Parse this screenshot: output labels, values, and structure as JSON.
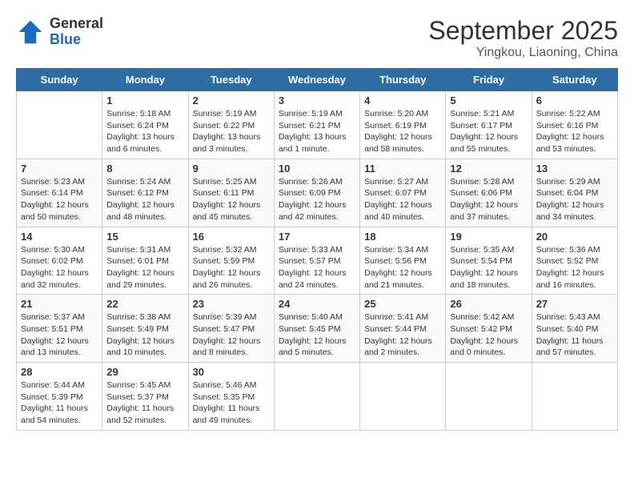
{
  "logo": {
    "line1": "General",
    "line2": "Blue"
  },
  "title": "September 2025",
  "subtitle": "Yingkou, Liaoning, China",
  "columns": [
    "Sunday",
    "Monday",
    "Tuesday",
    "Wednesday",
    "Thursday",
    "Friday",
    "Saturday"
  ],
  "weeks": [
    [
      {
        "day": "",
        "text": ""
      },
      {
        "day": "1",
        "text": "Sunrise: 5:18 AM\nSunset: 6:24 PM\nDaylight: 13 hours\nand 6 minutes."
      },
      {
        "day": "2",
        "text": "Sunrise: 5:19 AM\nSunset: 6:22 PM\nDaylight: 13 hours\nand 3 minutes."
      },
      {
        "day": "3",
        "text": "Sunrise: 5:19 AM\nSunset: 6:21 PM\nDaylight: 13 hours\nand 1 minute."
      },
      {
        "day": "4",
        "text": "Sunrise: 5:20 AM\nSunset: 6:19 PM\nDaylight: 12 hours\nand 58 minutes."
      },
      {
        "day": "5",
        "text": "Sunrise: 5:21 AM\nSunset: 6:17 PM\nDaylight: 12 hours\nand 55 minutes."
      },
      {
        "day": "6",
        "text": "Sunrise: 5:22 AM\nSunset: 6:16 PM\nDaylight: 12 hours\nand 53 minutes."
      }
    ],
    [
      {
        "day": "7",
        "text": "Sunrise: 5:23 AM\nSunset: 6:14 PM\nDaylight: 12 hours\nand 50 minutes."
      },
      {
        "day": "8",
        "text": "Sunrise: 5:24 AM\nSunset: 6:12 PM\nDaylight: 12 hours\nand 48 minutes."
      },
      {
        "day": "9",
        "text": "Sunrise: 5:25 AM\nSunset: 6:11 PM\nDaylight: 12 hours\nand 45 minutes."
      },
      {
        "day": "10",
        "text": "Sunrise: 5:26 AM\nSunset: 6:09 PM\nDaylight: 12 hours\nand 42 minutes."
      },
      {
        "day": "11",
        "text": "Sunrise: 5:27 AM\nSunset: 6:07 PM\nDaylight: 12 hours\nand 40 minutes."
      },
      {
        "day": "12",
        "text": "Sunrise: 5:28 AM\nSunset: 6:06 PM\nDaylight: 12 hours\nand 37 minutes."
      },
      {
        "day": "13",
        "text": "Sunrise: 5:29 AM\nSunset: 6:04 PM\nDaylight: 12 hours\nand 34 minutes."
      }
    ],
    [
      {
        "day": "14",
        "text": "Sunrise: 5:30 AM\nSunset: 6:02 PM\nDaylight: 12 hours\nand 32 minutes."
      },
      {
        "day": "15",
        "text": "Sunrise: 5:31 AM\nSunset: 6:01 PM\nDaylight: 12 hours\nand 29 minutes."
      },
      {
        "day": "16",
        "text": "Sunrise: 5:32 AM\nSunset: 5:59 PM\nDaylight: 12 hours\nand 26 minutes."
      },
      {
        "day": "17",
        "text": "Sunrise: 5:33 AM\nSunset: 5:57 PM\nDaylight: 12 hours\nand 24 minutes."
      },
      {
        "day": "18",
        "text": "Sunrise: 5:34 AM\nSunset: 5:56 PM\nDaylight: 12 hours\nand 21 minutes."
      },
      {
        "day": "19",
        "text": "Sunrise: 5:35 AM\nSunset: 5:54 PM\nDaylight: 12 hours\nand 18 minutes."
      },
      {
        "day": "20",
        "text": "Sunrise: 5:36 AM\nSunset: 5:52 PM\nDaylight: 12 hours\nand 16 minutes."
      }
    ],
    [
      {
        "day": "21",
        "text": "Sunrise: 5:37 AM\nSunset: 5:51 PM\nDaylight: 12 hours\nand 13 minutes."
      },
      {
        "day": "22",
        "text": "Sunrise: 5:38 AM\nSunset: 5:49 PM\nDaylight: 12 hours\nand 10 minutes."
      },
      {
        "day": "23",
        "text": "Sunrise: 5:39 AM\nSunset: 5:47 PM\nDaylight: 12 hours\nand 8 minutes."
      },
      {
        "day": "24",
        "text": "Sunrise: 5:40 AM\nSunset: 5:45 PM\nDaylight: 12 hours\nand 5 minutes."
      },
      {
        "day": "25",
        "text": "Sunrise: 5:41 AM\nSunset: 5:44 PM\nDaylight: 12 hours\nand 2 minutes."
      },
      {
        "day": "26",
        "text": "Sunrise: 5:42 AM\nSunset: 5:42 PM\nDaylight: 12 hours\nand 0 minutes."
      },
      {
        "day": "27",
        "text": "Sunrise: 5:43 AM\nSunset: 5:40 PM\nDaylight: 11 hours\nand 57 minutes."
      }
    ],
    [
      {
        "day": "28",
        "text": "Sunrise: 5:44 AM\nSunset: 5:39 PM\nDaylight: 11 hours\nand 54 minutes."
      },
      {
        "day": "29",
        "text": "Sunrise: 5:45 AM\nSunset: 5:37 PM\nDaylight: 11 hours\nand 52 minutes."
      },
      {
        "day": "30",
        "text": "Sunrise: 5:46 AM\nSunset: 5:35 PM\nDaylight: 11 hours\nand 49 minutes."
      },
      {
        "day": "",
        "text": ""
      },
      {
        "day": "",
        "text": ""
      },
      {
        "day": "",
        "text": ""
      },
      {
        "day": "",
        "text": ""
      }
    ]
  ]
}
